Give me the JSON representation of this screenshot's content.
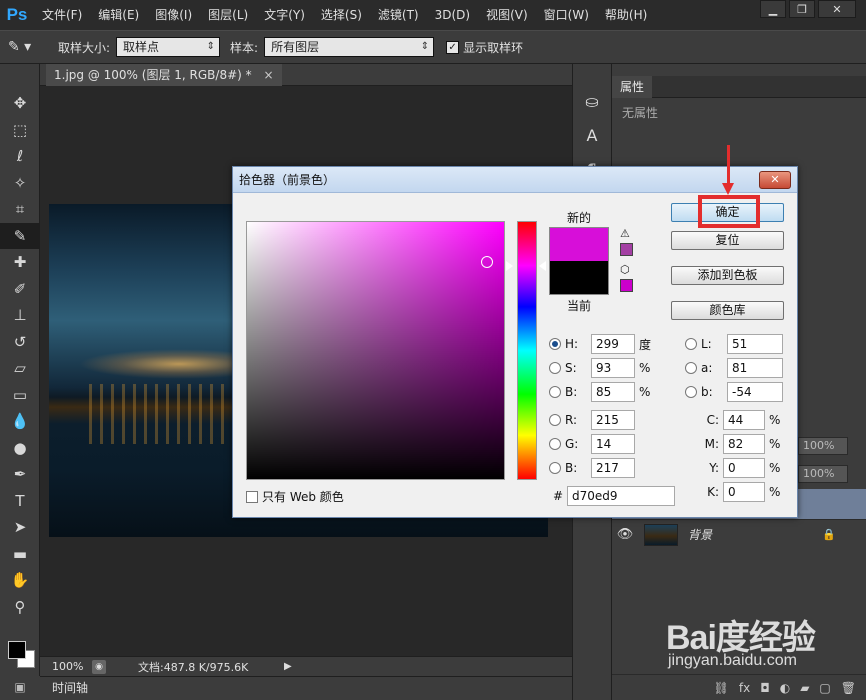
{
  "app": {
    "logo": "Ps"
  },
  "menubar": {
    "items": [
      "文件(F)",
      "编辑(E)",
      "图像(I)",
      "图层(L)",
      "文字(Y)",
      "选择(S)",
      "滤镜(T)",
      "3D(D)",
      "视图(V)",
      "窗口(W)",
      "帮助(H)"
    ]
  },
  "window_controls": {
    "minimize": "▁",
    "maximize": "❐",
    "close": "✕"
  },
  "options": {
    "sample_size_label": "取样大小:",
    "sample_size_value": "取样点",
    "sample_label": "样本:",
    "sample_value": "所有图层",
    "show_ring_label": "显示取样环",
    "show_ring_checked": true
  },
  "document": {
    "tab_title": "1.jpg @ 100% (图层 1, RGB/8#) *",
    "tab_close": "×"
  },
  "status": {
    "zoom": "100%",
    "doc_info": "文档:487.8 K/975.6K"
  },
  "timeline": {
    "label": "时间轴"
  },
  "properties_panel": {
    "tab": "属性",
    "empty_text": "无属性"
  },
  "layers": {
    "opacity_value": "100%",
    "fill_value": "100%",
    "items": [
      {
        "name": "背景",
        "locked": true
      }
    ]
  },
  "color_picker": {
    "title": "拾色器（前景色）",
    "new_label": "新的",
    "current_label": "当前",
    "new_color": "#d70ed9",
    "current_color": "#000000",
    "buttons": {
      "ok": "确定",
      "reset": "复位",
      "add_swatch": "添加到色板",
      "libraries": "颜色库"
    },
    "hsb": {
      "H": "299",
      "S": "93",
      "B": "85",
      "H_unit": "度",
      "S_unit": "%",
      "B_unit": "%"
    },
    "rgb": {
      "R": "215",
      "G": "14",
      "B": "217"
    },
    "lab": {
      "L": "51",
      "a": "81",
      "b": "-54"
    },
    "cmyk": {
      "C": "44",
      "M": "82",
      "Y": "0",
      "K": "0",
      "unit": "%"
    },
    "hex_label": "#",
    "hex": "d70ed9",
    "web_only_label": "只有 Web 颜色",
    "selected_mode": "H"
  },
  "watermark": {
    "main": "Bai度经验",
    "sub": "jingyan.baidu.com"
  }
}
